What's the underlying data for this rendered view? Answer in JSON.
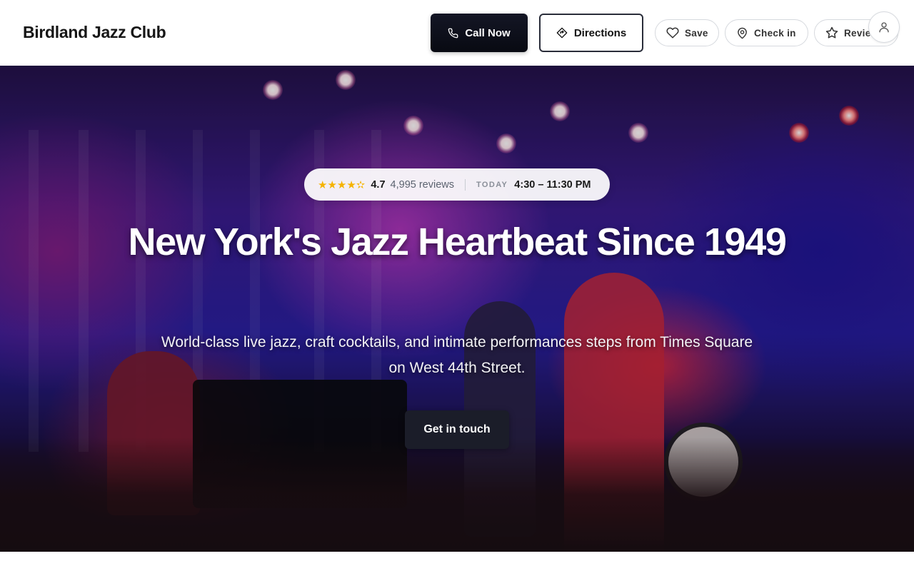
{
  "header": {
    "brand": "Birdland Jazz Club",
    "call_label": "Call Now",
    "directions_label": "Directions",
    "save_label": "Save",
    "checkin_label": "Check in",
    "review_label": "Review"
  },
  "hero": {
    "stars": "★★★★✫",
    "rating": "4.7",
    "reviews": "4,995 reviews",
    "today_label": "TODAY",
    "hours": "4:30 – 11:30 PM",
    "headline": "New York's Jazz Heartbeat Since 1949",
    "subheadline": "World-class live jazz, craft cocktails, and intimate performances steps from Times Square on West 44th Street.",
    "cta_label": "Get in touch"
  },
  "icons": {
    "call": "phone-icon",
    "directions": "directions-icon",
    "save": "heart-icon",
    "checkin": "location-pin-icon",
    "review": "star-icon",
    "account": "user-icon"
  },
  "colors": {
    "primary_dark": "#141625",
    "star": "#f5b301",
    "cta": "#1b1d29"
  }
}
